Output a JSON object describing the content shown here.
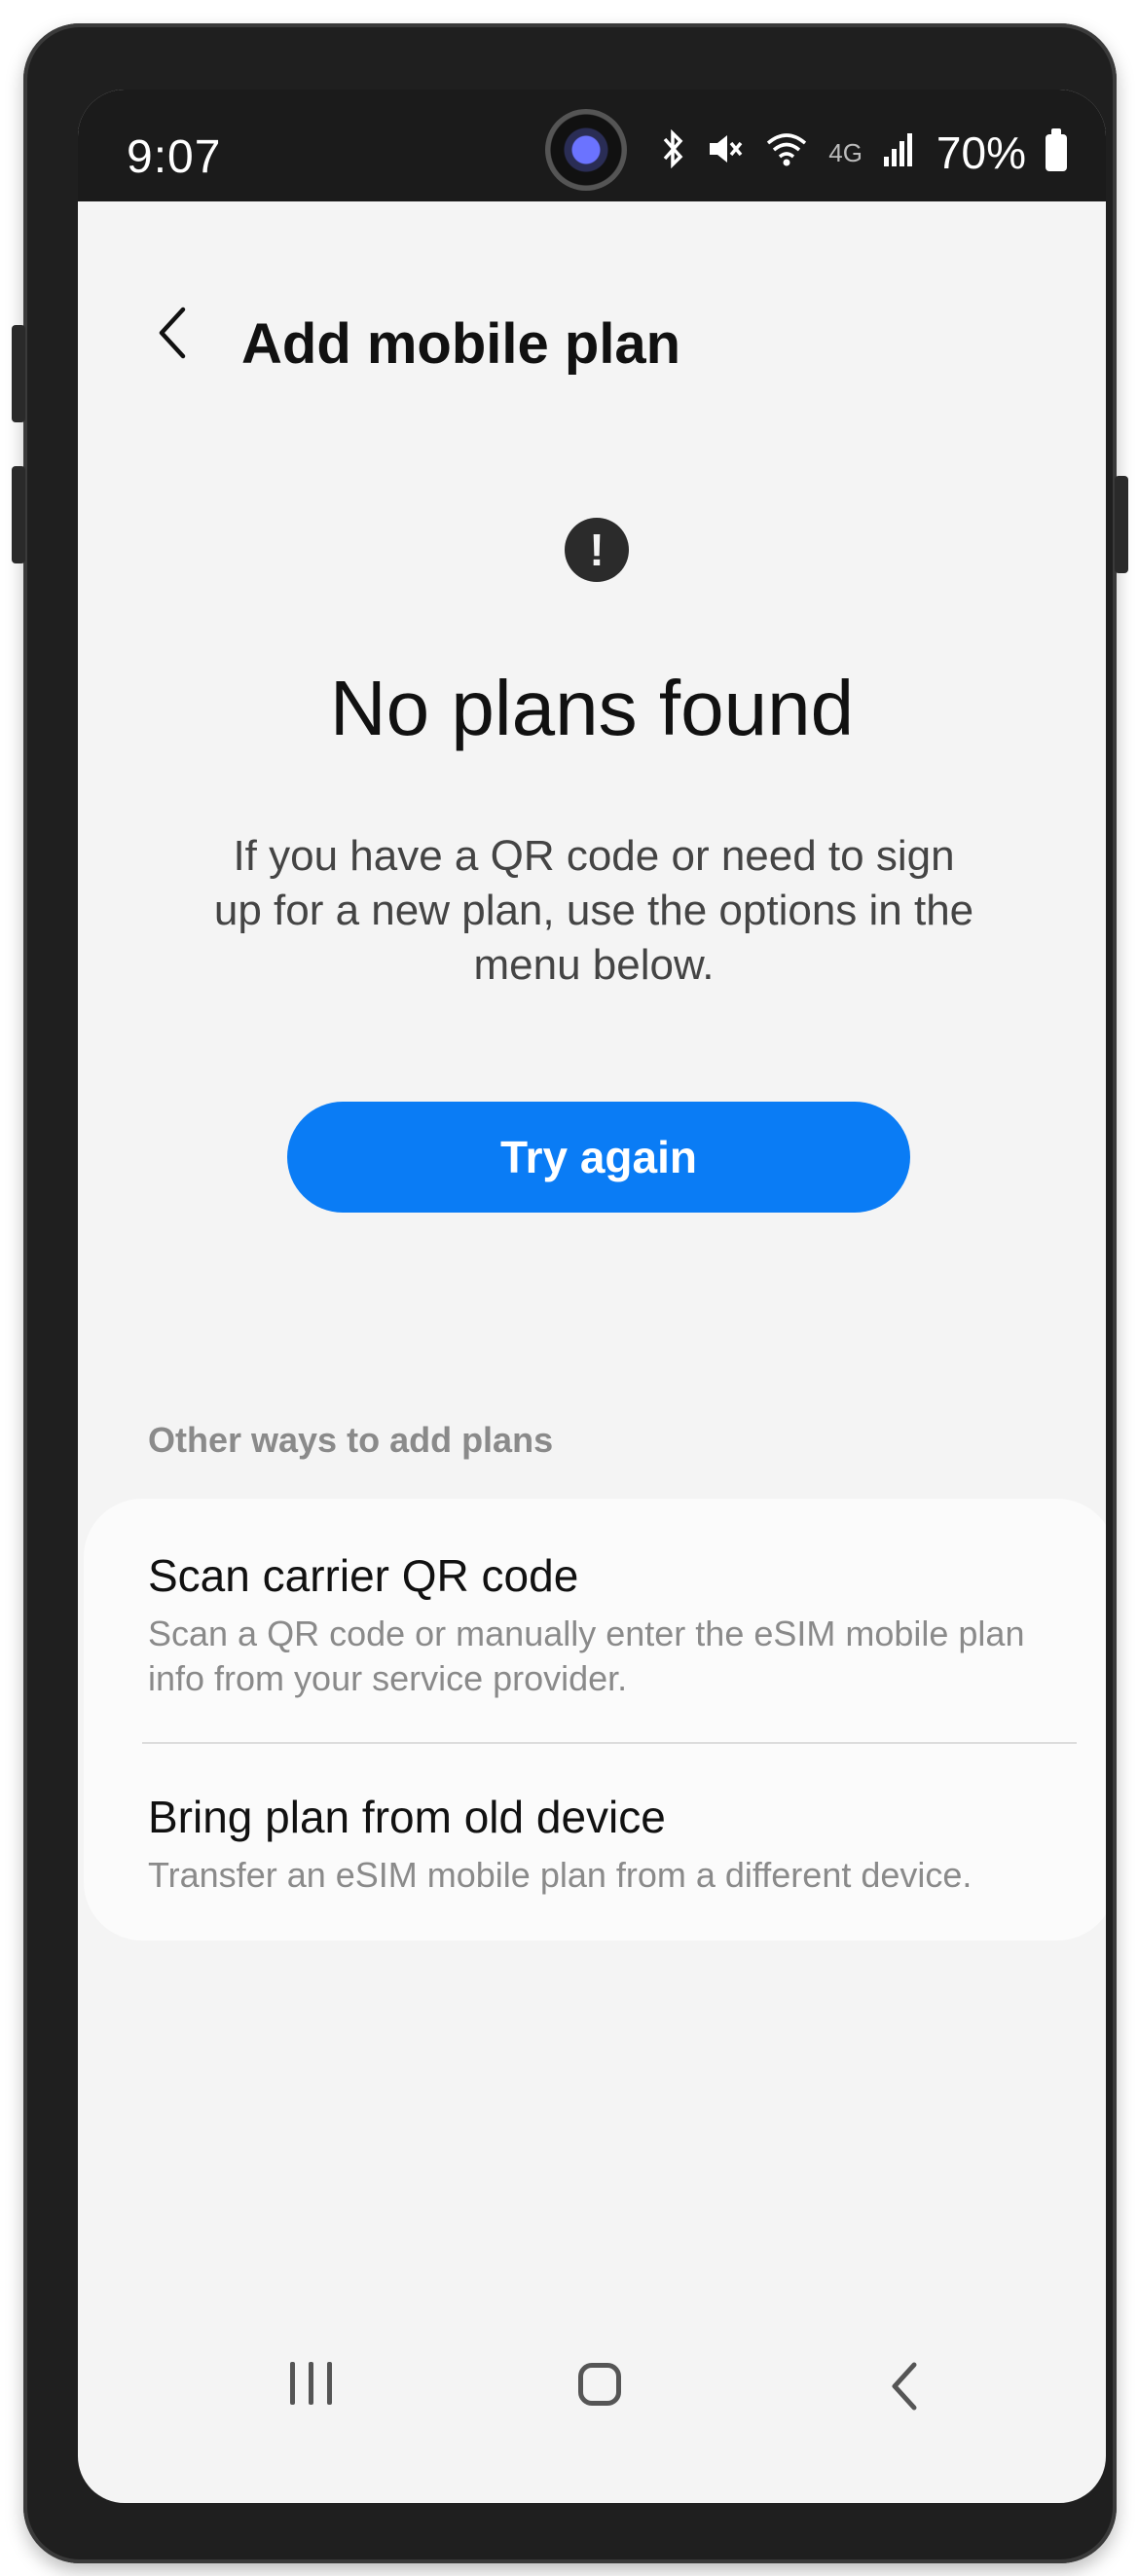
{
  "status_bar": {
    "time": "9:07",
    "network_label": "4G",
    "battery_percent": "70%",
    "icons": [
      "bluetooth-icon",
      "mute-icon",
      "wifi-icon",
      "network-4g-icon",
      "signal-icon",
      "battery-icon"
    ]
  },
  "app_bar": {
    "title": "Add mobile plan",
    "back_icon": "back-arrow-icon"
  },
  "main": {
    "alert_icon": "exclamation-circle-icon",
    "heading": "No plans found",
    "description": "If you have a QR code or need to sign up for a new plan, use the options in the menu below.",
    "try_again_label": "Try again"
  },
  "other_ways": {
    "section_label": "Other ways to add plans",
    "items": [
      {
        "title": "Scan carrier QR code",
        "subtitle": "Scan a QR code or manually enter the eSIM mobile plan info from your service provider."
      },
      {
        "title": "Bring plan from old device",
        "subtitle": "Transfer an eSIM mobile plan from a different device."
      }
    ]
  },
  "nav_bar": {
    "icons": [
      "recents-icon",
      "home-icon",
      "back-icon"
    ]
  },
  "colors": {
    "accent": "#0a7cf5",
    "background": "#f4f4f4",
    "card": "#fbfbfb",
    "status_bar": "#1b1b1b"
  }
}
